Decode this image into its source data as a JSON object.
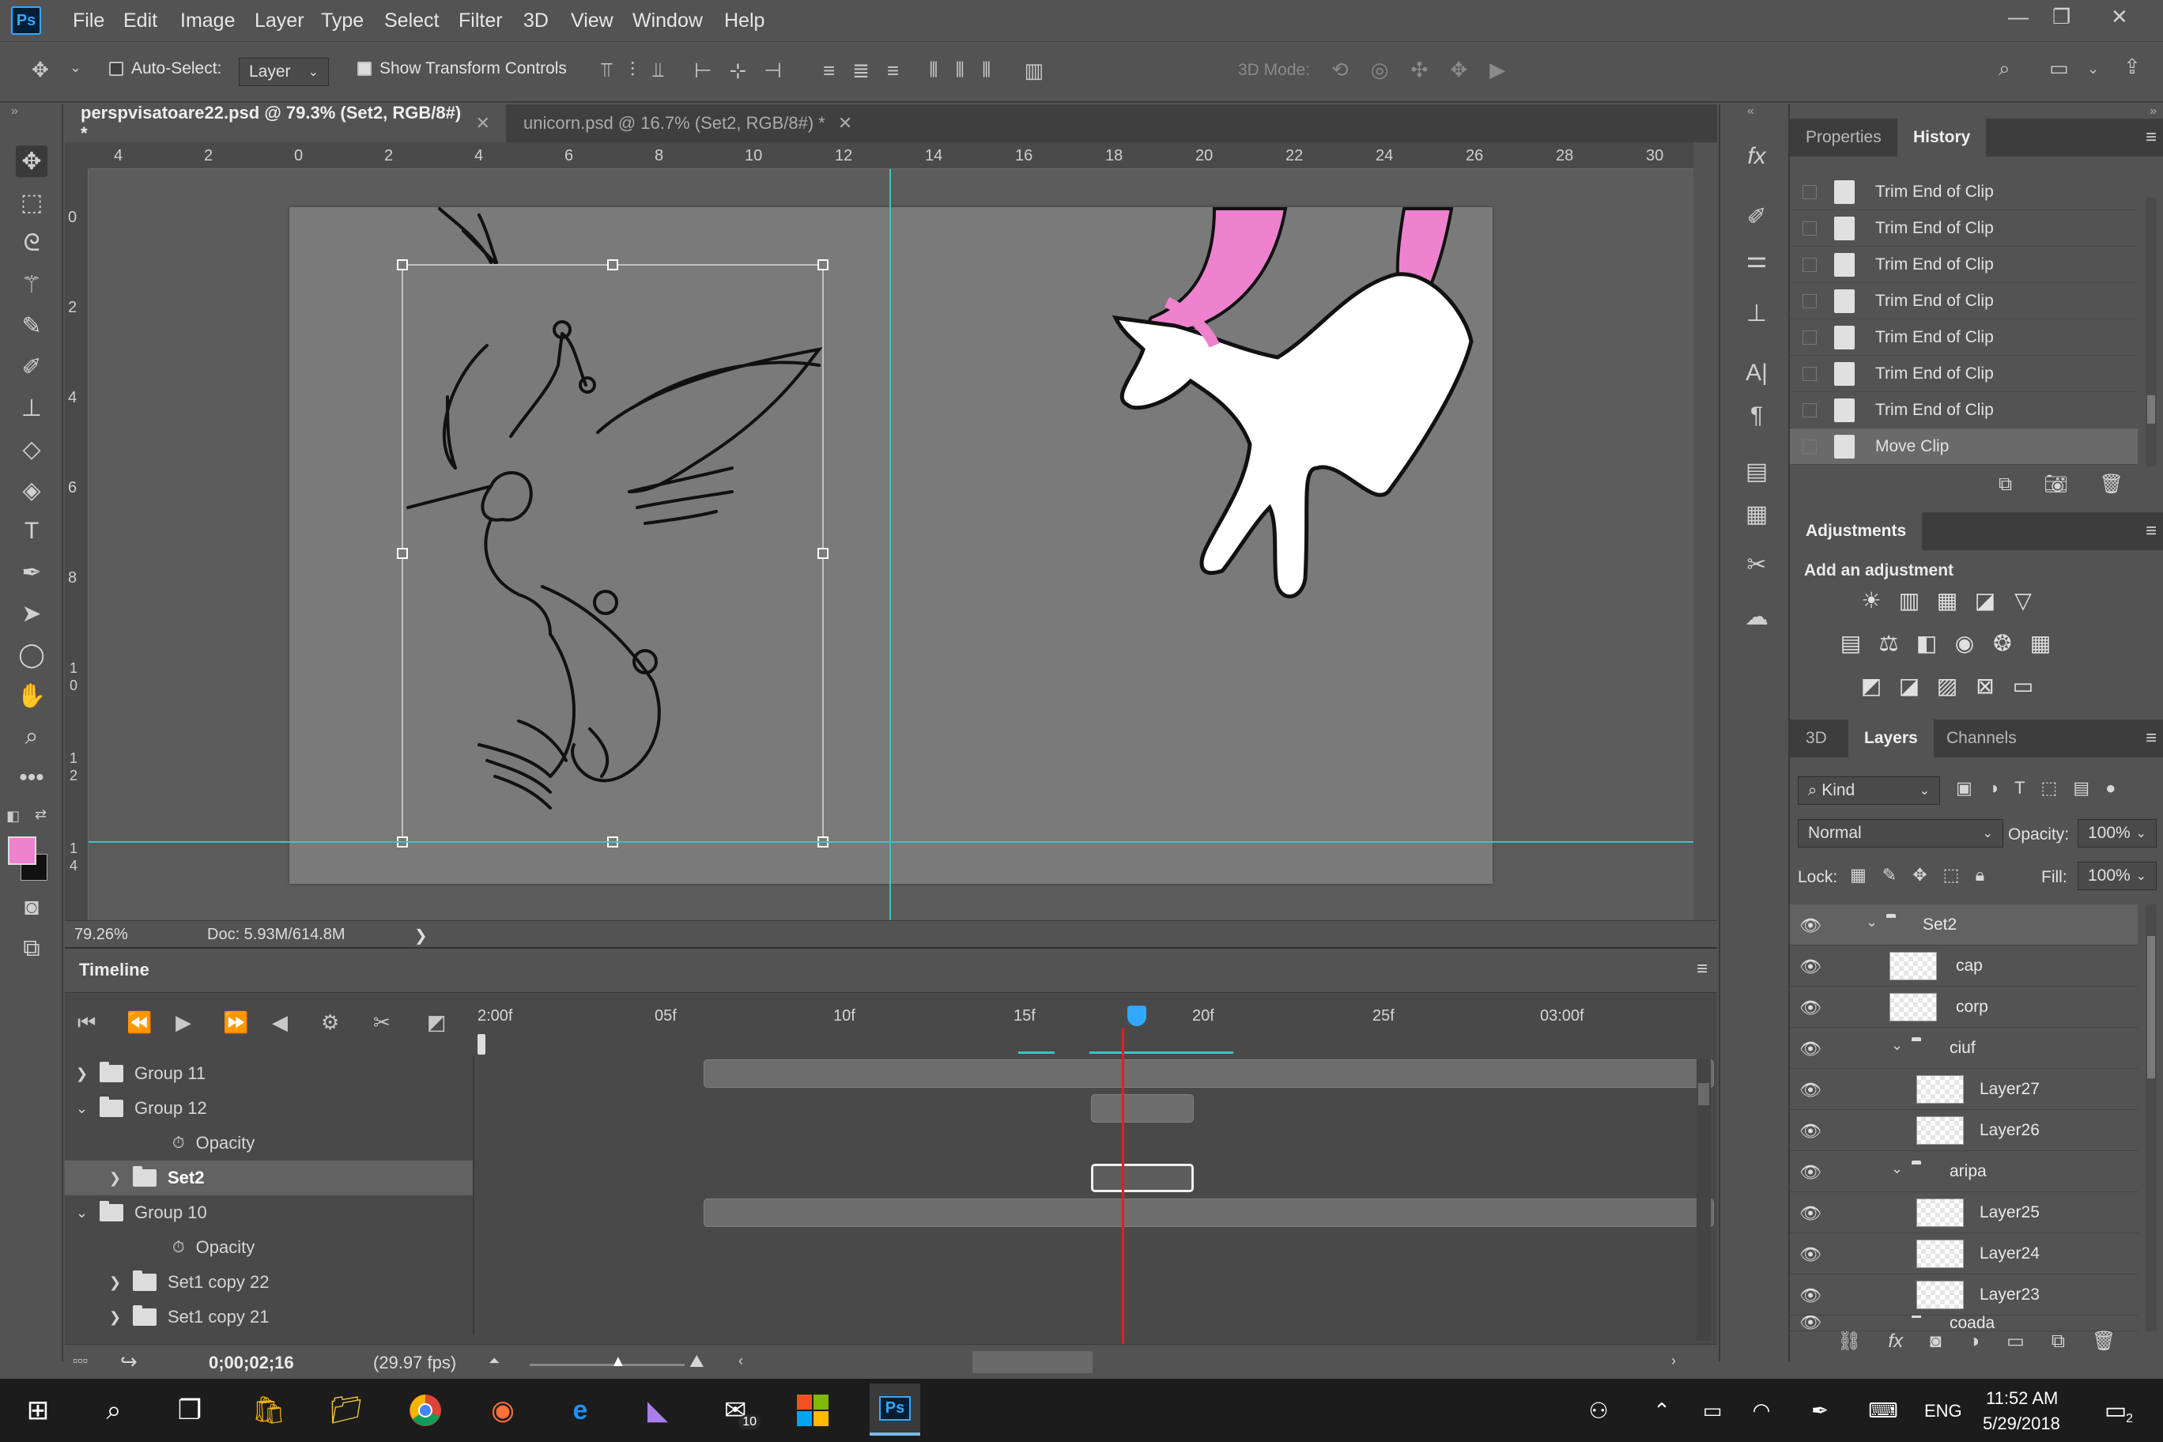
{
  "app": {
    "logo": "Ps"
  },
  "menu": [
    "File",
    "Edit",
    "Image",
    "Layer",
    "Type",
    "Select",
    "Filter",
    "3D",
    "View",
    "Window",
    "Help"
  ],
  "window_controls": {
    "minimize": "—",
    "restore": "❐",
    "close": "✕"
  },
  "options_bar": {
    "auto_select_label": "Auto-Select:",
    "auto_select_checked": false,
    "layer_dropdown": "Layer",
    "show_transform_label": "Show Transform Controls",
    "show_transform_checked": true,
    "mode_3d_label": "3D Mode:"
  },
  "tabs": [
    {
      "label": "perspvisatoare22.psd @ 79.3% (Set2, RGB/8#) *",
      "active": true
    },
    {
      "label": "unicorn.psd @ 16.7% (Set2, RGB/8#) *",
      "active": false
    }
  ],
  "ruler_top": [
    "4",
    "2",
    "0",
    "2",
    "4",
    "6",
    "8",
    "10",
    "12",
    "14",
    "16",
    "18",
    "20",
    "22",
    "24",
    "26",
    "28",
    "30"
  ],
  "ruler_left": [
    "0",
    "2",
    "4",
    "6",
    "8",
    "1\n0",
    "1\n2",
    "1\n4"
  ],
  "status": {
    "zoom": "79.26%",
    "doc": "Doc: 5.93M/614.8M",
    "arrow": "❯"
  },
  "colors": {
    "foreground": "#ee82cf",
    "background": "#000000",
    "guide": "#3fc1c9",
    "playhead": "#e02020",
    "accent": "#31a8ff"
  },
  "timeline": {
    "title": "Timeline",
    "ruler_labels": [
      "2:00f",
      "05f",
      "10f",
      "15f",
      "20f",
      "25f",
      "03:00f"
    ],
    "current_time": "0;00;02;16",
    "fps": "(29.97 fps)",
    "rows": [
      {
        "label": "Group 11",
        "expanded": false,
        "type": "group"
      },
      {
        "label": "Group 12",
        "expanded": true,
        "type": "group"
      },
      {
        "label": "Opacity",
        "type": "property"
      },
      {
        "label": "Set2",
        "expanded": false,
        "type": "group",
        "selected": true
      },
      {
        "label": "Group 10",
        "expanded": true,
        "type": "group"
      },
      {
        "label": "Opacity",
        "type": "property"
      },
      {
        "label": "Set1 copy 22",
        "expanded": false,
        "type": "group"
      },
      {
        "label": "Set1 copy 21",
        "expanded": false,
        "type": "group"
      }
    ]
  },
  "history": {
    "tabs": [
      "Properties",
      "History"
    ],
    "items": [
      "Trim End of Clip",
      "Trim End of Clip",
      "Trim End of Clip",
      "Trim End of Clip",
      "Trim End of Clip",
      "Trim End of Clip",
      "Trim End of Clip",
      "Move Clip"
    ]
  },
  "adjustments": {
    "title": "Adjustments",
    "subtitle": "Add an adjustment"
  },
  "layers": {
    "tabs": [
      "3D",
      "Layers",
      "Channels"
    ],
    "filter_kind": "Kind",
    "blend_mode": "Normal",
    "opacity_label": "Opacity:",
    "opacity_value": "100%",
    "lock_label": "Lock:",
    "fill_label": "Fill:",
    "fill_value": "100%",
    "items": [
      {
        "name": "Set2",
        "type": "group",
        "indent": 0,
        "expanded": true,
        "selected": true
      },
      {
        "name": "cap",
        "type": "layer",
        "indent": 1
      },
      {
        "name": "corp",
        "type": "layer",
        "indent": 1
      },
      {
        "name": "ciuf",
        "type": "group",
        "indent": 1,
        "expanded": true
      },
      {
        "name": "Layer27",
        "type": "layer",
        "indent": 2
      },
      {
        "name": "Layer26",
        "type": "layer",
        "indent": 2
      },
      {
        "name": "aripa",
        "type": "group",
        "indent": 1,
        "expanded": true
      },
      {
        "name": "Layer25",
        "type": "layer",
        "indent": 2
      },
      {
        "name": "Layer24",
        "type": "layer",
        "indent": 2
      },
      {
        "name": "Layer23",
        "type": "layer",
        "indent": 2
      },
      {
        "name": "coada",
        "type": "group",
        "indent": 1,
        "expanded": true
      }
    ]
  },
  "taskbar": {
    "mail_badge": "10",
    "language": "ENG",
    "time": "11:52 AM",
    "date": "5/29/2018",
    "notification_count": "2"
  }
}
